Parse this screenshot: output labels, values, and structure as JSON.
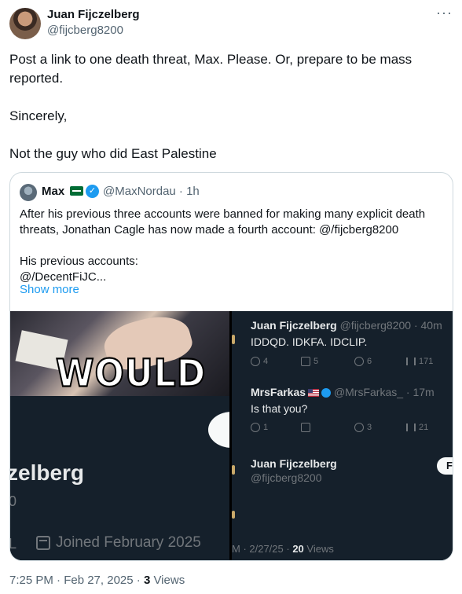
{
  "tweet": {
    "author_name": "Juan Fijczelberg",
    "author_handle": "@fijcberg8200",
    "more": "···",
    "paragraphs": [
      "Post a link to one death threat, Max. Please. Or, prepare to be mass reported.",
      "Sincerely,",
      "Not the guy who did East Palestine"
    ],
    "footer_time": "7:25 PM · Feb 27, 2025 · ",
    "footer_views_count": "3",
    "footer_views_label": " Views"
  },
  "quote": {
    "name": "Max",
    "handle": "@MaxNordau · 1h",
    "verified_mark": "✓",
    "lines": [
      "After his previous three accounts were banned for making many explicit death",
      "threats, Jonathan Cagle has now made a fourth account: @/fijcberg8200",
      "",
      "His previous accounts:",
      "@/DecentFiJC..."
    ],
    "show_more": "Show more"
  },
  "media": {
    "gif_caption": "WOULD",
    "left_name_fragment": "zelberg",
    "left_zero": "0",
    "left_l": "L",
    "joined": "Joined February 2025",
    "right": {
      "reply1_name": "Juan Fijczelberg",
      "reply1_handle": "@fijcberg8200 · 40m",
      "reply1_text": "IDDQD. IDKFA. IDCLIP.",
      "reply1_stats": [
        "4",
        "5",
        "6",
        "171"
      ],
      "reply2_name": "MrsFarkas",
      "reply2_handle": "@MrsFarkas_ · 17m",
      "reply2_text": "Is that you?",
      "reply2_stats": [
        "1",
        "",
        "3",
        "21"
      ],
      "profile_name": "Juan Fijczelberg",
      "profile_handle": "@fijcberg8200",
      "follow": "Foll",
      "footer_prefix": "M · 2/27/25 · ",
      "footer_views": "20",
      "footer_views_label": " Views"
    }
  },
  "colors": {
    "accent": "#1d9bf0",
    "dark_bg": "#15202b",
    "muted": "#536471"
  }
}
